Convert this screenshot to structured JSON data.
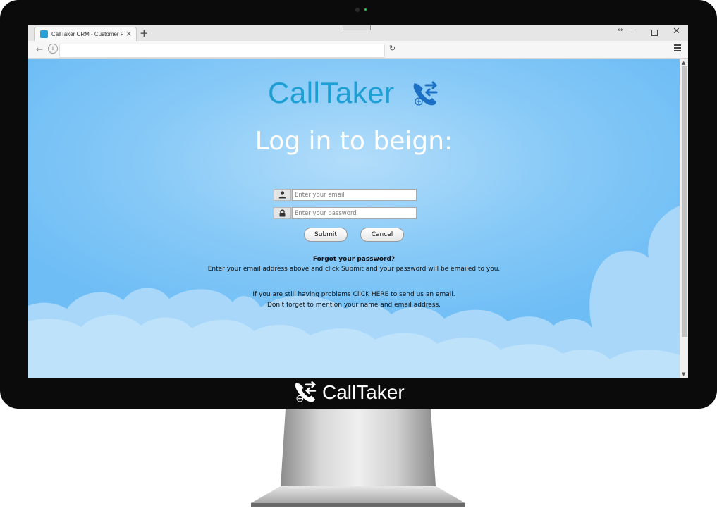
{
  "browser": {
    "tab_title": "CallTaker CRM - Customer R",
    "url_value": "",
    "search_value": ""
  },
  "page": {
    "logo_text": "CallTaker",
    "heading": "Log in to beign:",
    "email_placeholder": "Enter your email",
    "password_placeholder": "Enter your password",
    "submit_label": "Submit",
    "cancel_label": "Cancel",
    "forgot_title": "Forgot your password?",
    "forgot_desc": "Enter your email address above and click Submit and your password will be emailed to you.",
    "help_line1": "If you are still having problems CliCK HERE to send us an email.",
    "help_line2": "Don't forget to mention your name and email address."
  },
  "bezel": {
    "logo_text": "CallTaker"
  },
  "colors": {
    "brand": "#1e9fd4",
    "sky": "#86c9f7",
    "cloud": "#a8d7fa",
    "heading": "#ffffff",
    "monitor": "#0b0b0b"
  },
  "icons": {
    "tab": "calltaker-favicon",
    "email": "user-icon",
    "password": "lock-icon",
    "logo": "phone-arrows-icon"
  }
}
